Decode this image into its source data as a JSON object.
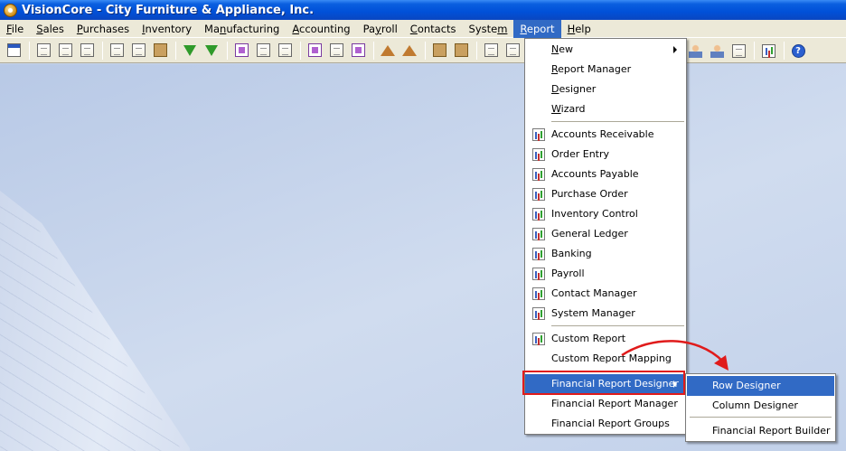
{
  "window": {
    "title": "VisionCore - City Furniture & Appliance, Inc."
  },
  "menubar": {
    "items": [
      {
        "pre": "",
        "u": "F",
        "post": "ile"
      },
      {
        "pre": "",
        "u": "S",
        "post": "ales"
      },
      {
        "pre": "",
        "u": "P",
        "post": "urchases"
      },
      {
        "pre": "",
        "u": "I",
        "post": "nventory"
      },
      {
        "pre": "Ma",
        "u": "n",
        "post": "ufacturing"
      },
      {
        "pre": "",
        "u": "A",
        "post": "ccounting"
      },
      {
        "pre": "Pa",
        "u": "y",
        "post": "roll"
      },
      {
        "pre": "",
        "u": "C",
        "post": "ontacts"
      },
      {
        "pre": "Syste",
        "u": "m",
        "post": ""
      },
      {
        "pre": "",
        "u": "R",
        "post": "eport"
      },
      {
        "pre": "",
        "u": "H",
        "post": "elp"
      }
    ]
  },
  "report_menu": {
    "top": [
      {
        "pre": "",
        "u": "N",
        "post": "ew"
      },
      {
        "pre": "",
        "u": "R",
        "post": "eport Manager"
      },
      {
        "pre": "",
        "u": "D",
        "post": "esigner"
      },
      {
        "pre": "",
        "u": "W",
        "post": "izard"
      }
    ],
    "reports": [
      "Accounts Receivable",
      "Order Entry",
      "Accounts Payable",
      "Purchase Order",
      "Inventory Control",
      "General Ledger",
      "Banking",
      "Payroll",
      "Contact Manager",
      "System Manager"
    ],
    "custom": [
      "Custom Report",
      "Custom Report Mapping"
    ],
    "financial": [
      "Financial Report Designer",
      "Financial Report Manager",
      "Financial Report Groups"
    ]
  },
  "submenu": {
    "items": [
      "Row Designer",
      "Column Designer",
      "Financial Report Builder"
    ]
  },
  "colors": {
    "selection": "#316ac5",
    "annotation": "#e01b1b",
    "title_bar": "#0050d8"
  },
  "toolbar_icons": [
    "calendar-icon",
    "note-icon",
    "search-doc-icon",
    "flag-icon",
    "info-doc-icon",
    "order-doc-icon",
    "post-icon",
    "green-arrow-icon",
    "green-arrow-icon",
    "bill-icon",
    "purchase-icon",
    "po-icon",
    "b-doc-icon",
    "report-doc-icon",
    "po-doc-icon",
    "house-icon",
    "house-up-icon",
    "box-icon",
    "truck-icon",
    "tag-icon",
    "building-icon",
    "person-icon",
    "person2-icon",
    "chart-icon",
    "help-icon"
  ]
}
